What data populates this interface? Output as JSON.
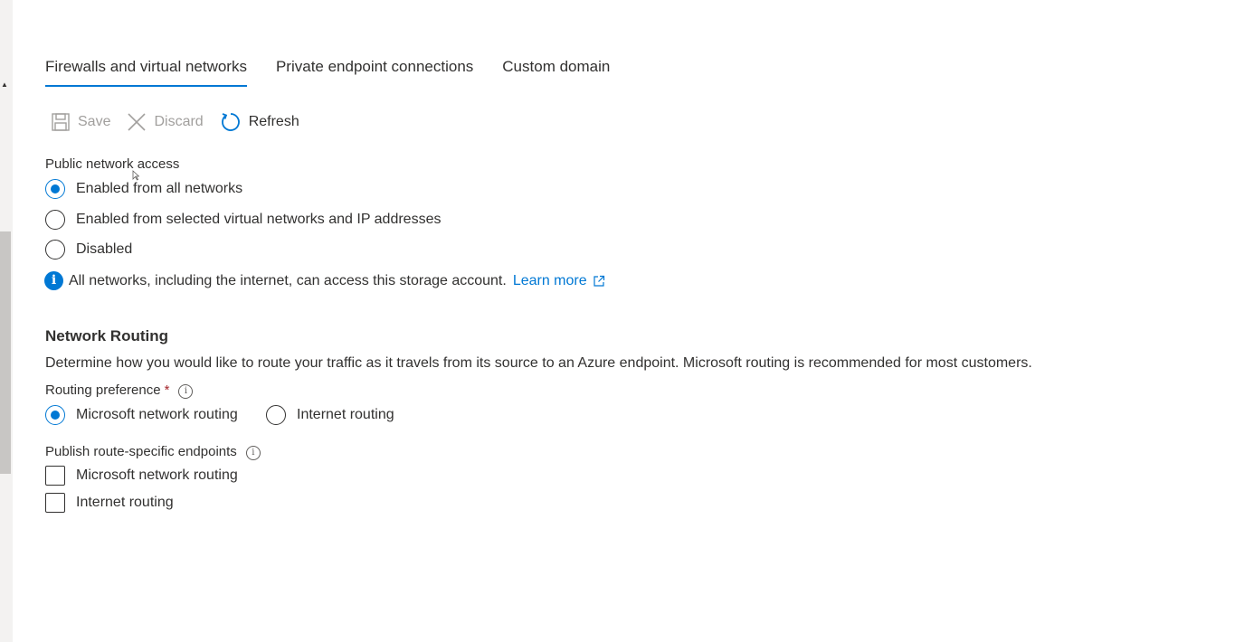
{
  "tabs": [
    {
      "label": "Firewalls and virtual networks",
      "active": true
    },
    {
      "label": "Private endpoint connections",
      "active": false
    },
    {
      "label": "Custom domain",
      "active": false
    }
  ],
  "toolbar": {
    "save_label": "Save",
    "discard_label": "Discard",
    "refresh_label": "Refresh"
  },
  "public_access": {
    "label": "Public network access",
    "options": [
      {
        "label": "Enabled from all networks",
        "checked": true
      },
      {
        "label": "Enabled from selected virtual networks and IP addresses",
        "checked": false
      },
      {
        "label": "Disabled",
        "checked": false
      }
    ],
    "info_text": "All networks, including the internet, can access this storage account.",
    "learn_more": "Learn more"
  },
  "network_routing": {
    "title": "Network Routing",
    "description": "Determine how you would like to route your traffic as it travels from its source to an Azure endpoint. Microsoft routing is recommended for most customers.",
    "preference_label": "Routing preference",
    "required_mark": "*",
    "preference_options": [
      {
        "label": "Microsoft network routing",
        "checked": true
      },
      {
        "label": "Internet routing",
        "checked": false
      }
    ],
    "publish_label": "Publish route-specific endpoints",
    "publish_options": [
      {
        "label": "Microsoft network routing",
        "checked": false
      },
      {
        "label": "Internet routing",
        "checked": false
      }
    ]
  },
  "colors": {
    "accent": "#0078d4",
    "disabled_text": "#a19f9d",
    "required": "#a4262c"
  }
}
